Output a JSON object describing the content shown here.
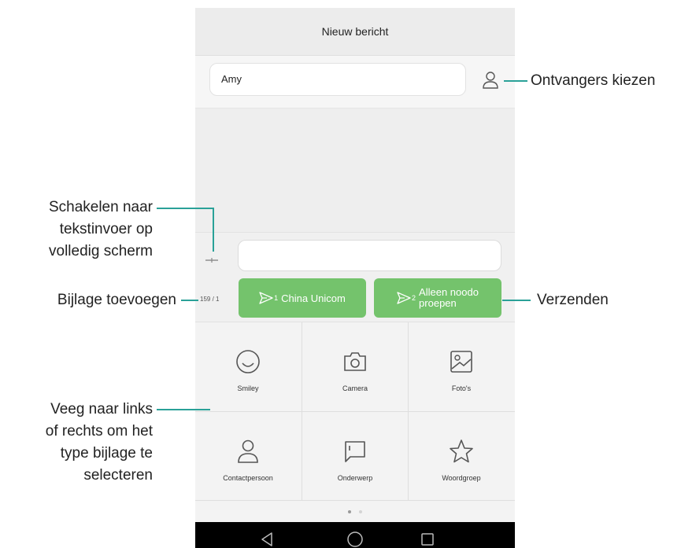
{
  "header": {
    "title": "Nieuw bericht"
  },
  "recipient": {
    "value": "Amy"
  },
  "composer": {
    "counter": "159 / 1",
    "send_sim1": {
      "label": "China Unicom",
      "sim": "1"
    },
    "send_sim2": {
      "label_line1": "Alleen noodo",
      "label_line2": "proepen",
      "sim": "2"
    }
  },
  "attachments": [
    {
      "label": "Smiley",
      "icon": "smiley-icon"
    },
    {
      "label": "Camera",
      "icon": "camera-icon"
    },
    {
      "label": "Foto's",
      "icon": "photo-icon"
    },
    {
      "label": "Contactpersoon",
      "icon": "contact-icon"
    },
    {
      "label": "Onderwerp",
      "icon": "subject-icon"
    },
    {
      "label": "Woordgroep",
      "icon": "star-icon"
    }
  ],
  "page_indicator": {
    "pages": 2,
    "current": 1
  },
  "callouts": {
    "recipients": "Ontvangers kiezen",
    "fullscreen_line1": "Schakelen naar",
    "fullscreen_line2": "tekstinvoer op",
    "fullscreen_line3": "volledig scherm",
    "attach": "Bijlage toevoegen",
    "send": "Verzenden",
    "swipe_line1": "Veeg naar links",
    "swipe_line2": "of rechts om het",
    "swipe_line3": "type bijlage te",
    "swipe_line4": "selecteren"
  },
  "colors": {
    "accent_green": "#74c36c",
    "callout_line": "#2aa198",
    "navbar": "#000000"
  }
}
